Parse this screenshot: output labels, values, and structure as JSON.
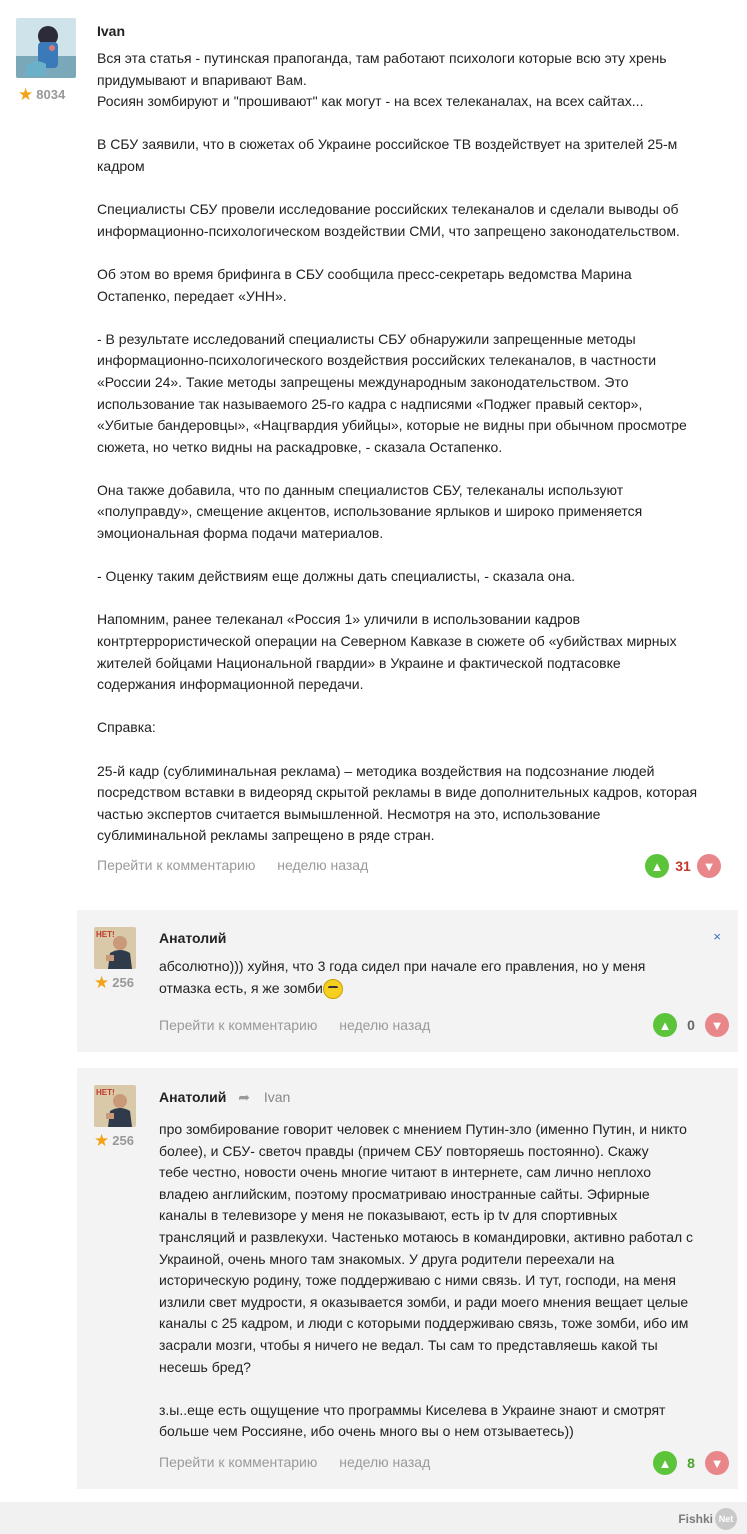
{
  "comments": [
    {
      "author": "Ivan",
      "rating": "8034",
      "text": "Вся эта статья - путинская прапоганда, там работают психологи которые всю эту хрень\nпридумывают и впаривают Вам.\nРосиян зомбируют и \"прошивают\" как могут - на всех телеканалах, на всех сайтах...\n\nВ СБУ заявили, что в сюжетах об Украине российское ТВ воздействует на зрителей 25-м\nкадром\n\nСпециалисты СБУ провели исследование российских телеканалов и сделали выводы об\nинформационно-психологическом воздействии СМИ, что запрещено законодательством.\n\nОб этом во время брифинга в СБУ сообщила пресс-секретарь ведомства Марина\nОстапенко, передает «УНН».\n\n- В результате исследований специалисты СБУ обнаружили запрещенные методы\nинформационно-психологического воздействия российских телеканалов, в частности\n«России 24». Такие методы запрещены международным законодательством. Это\nиспользование так называемого 25-го кадра с надписями «Поджег правый сектор»,\n«Убитые бандеровцы», «Нацгвардия убийцы», которые не видны при обычном просмотре\nсюжета, но четко видны на раскадровке, - сказала Остапенко.\n\nОна также добавила, что по данным специалистов СБУ, телеканалы используют\n«полуправду», смещение акцентов, использование ярлыков и широко применяется\nэмоциональная форма подачи материалов.\n\n- Оценку таким действиям еще должны дать специалисты, - сказала она.\n\nНапомним, ранее телеканал «Россия 1» уличили в использовании кадров\nконтртеррористической операции на Северном Кавказе в сюжете об «убийствах мирных\nжителей бойцами Национальной гвардии» в Украине и фактической подтасовке\nсодержания информационной передачи.\n\nСправка:\n\n25-й кадр (сублиминальная реклама) – методика воздействия на подсознание людей\nпосредством вставки в видеоряд скрытой рекламы в виде дополнительных кадров, которая\nчастью экспертов считается вымышленной. Несмотря на это, использование\nсублиминальной рекламы запрещено в ряде стран.",
      "link": "Перейти к комментарию",
      "time": "неделю назад",
      "score": "31"
    },
    {
      "author": "Анатолий",
      "rating": "256",
      "text": "абсолютно))) хуйня, что 3 года сидел при начале его правления, но у меня\nотмазка есть, я же зомби",
      "link": "Перейти к комментарию",
      "time": "неделю назад",
      "score": "0",
      "close": "×"
    },
    {
      "author": "Анатолий",
      "reply_to": "Ivan",
      "rating": "256",
      "text": "про зомбирование говорит человек с мнением Путин-зло (именно Путин, и никто\nболее), и СБУ- светоч правды (причем СБУ повторяешь постоянно). Скажу\nтебе честно, новости очень многие читают в интернете, сам лично неплохо\nвладею английским, поэтому просматриваю иностранные сайты. Эфирные\nканалы в телевизоре у меня не показывают, есть ip tv для спортивных\nтрансляций и развлекухи. Частенько мотаюсь в командировки, активно работал с\nУкраиной, очень много там знакомых. У друга родители переехали на\nисторическую родину, тоже поддерживаю с ними связь. И тут, господи, на меня\nизлили свет мудрости, я оказывается зомби, и ради моего мнения вещает целые\nканалы с 25 кадром, и люди с которыми поддерживаю связь, тоже зомби, ибо им\nзасрали мозги, чтобы я ничего не ведал. Ты сам то представляешь какой ты\nнесешь бред?\n\nз.ы..еще есть ощущение что программы Киселева в Украине знают и смотрят\nбольше чем Россияне, ибо очень много вы о нем отзываетесь))",
      "link": "Перейти к комментарию",
      "time": "неделю назад",
      "score": "8"
    }
  ],
  "footer": {
    "brand": "Fishki",
    "brand_net": "Net"
  },
  "colors": {
    "vote_up": "#5cc43a",
    "vote_down": "#e8868a",
    "score_red": "#c0392b",
    "score_green": "#4aa52a",
    "star": "#f2a31a"
  }
}
